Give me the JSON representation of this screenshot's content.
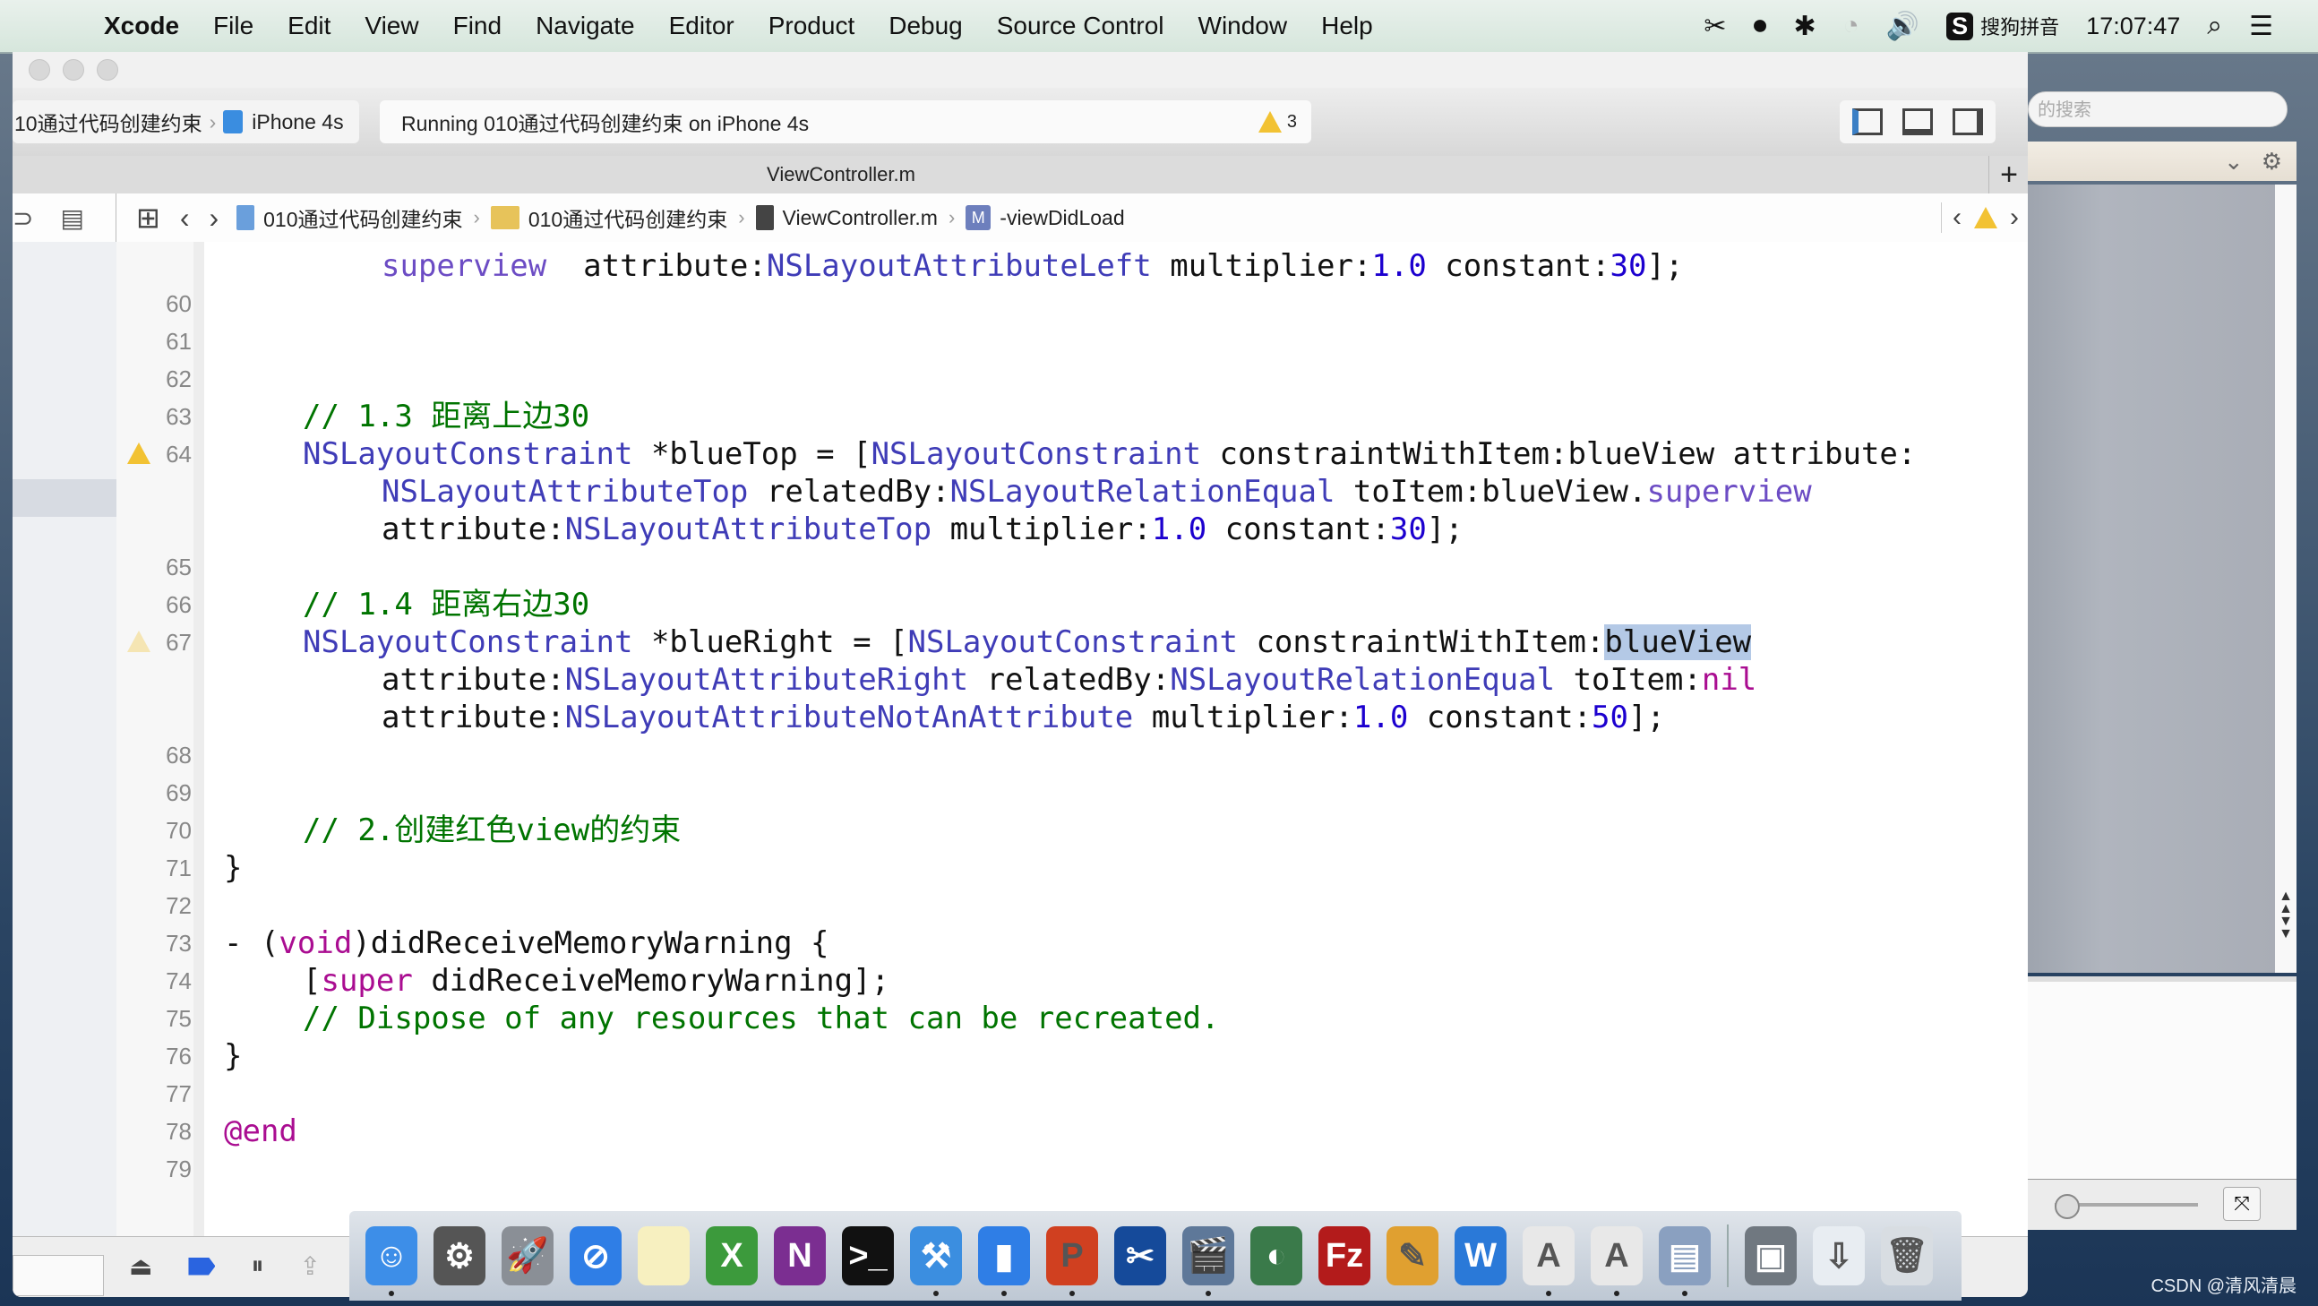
{
  "menubar": {
    "items": [
      "Xcode",
      "File",
      "Edit",
      "View",
      "Find",
      "Navigate",
      "Editor",
      "Product",
      "Debug",
      "Source Control",
      "Window",
      "Help"
    ],
    "input_method": "搜狗拼音",
    "ime_badge": "S",
    "clock": "17:07:47"
  },
  "toolbar": {
    "scheme": "10通过代码创建约束",
    "device": "iPhone 4s",
    "activity": "Running 010通过代码创建约束 on iPhone 4s",
    "warning_count": "3"
  },
  "tab": {
    "title": "ViewController.m",
    "add_label": "+"
  },
  "jumpbar": {
    "crumbs": [
      "010通过代码创建约束",
      "010通过代码创建约束",
      "ViewController.m",
      "-viewDidLoad"
    ],
    "method_badge": "M"
  },
  "editor": {
    "lines": [
      {
        "num": "",
        "text": "superview  attribute:NSLayoutAttributeLeft multiplier:1.0 constant:30];"
      },
      {
        "num": "60",
        "text": ""
      },
      {
        "num": "61",
        "text": ""
      },
      {
        "num": "62",
        "text": ""
      },
      {
        "num": "63",
        "text": "// 1.3 距离上边30"
      },
      {
        "num": "64",
        "text": "NSLayoutConstraint *blueTop = [NSLayoutConstraint constraintWithItem:blueView attribute:",
        "warning": true
      },
      {
        "num": "",
        "text": "NSLayoutAttributeTop relatedBy:NSLayoutRelationEqual toItem:blueView.superview"
      },
      {
        "num": "",
        "text": "attribute:NSLayoutAttributeTop multiplier:1.0 constant:30];"
      },
      {
        "num": "65",
        "text": ""
      },
      {
        "num": "66",
        "text": "// 1.4 距离右边30"
      },
      {
        "num": "67",
        "text": "NSLayoutConstraint *blueRight = [NSLayoutConstraint constraintWithItem:blueView",
        "warning": true
      },
      {
        "num": "",
        "text": "attribute:NSLayoutAttributeRight relatedBy:NSLayoutRelationEqual toItem:nil"
      },
      {
        "num": "",
        "text": "attribute:NSLayoutAttributeNotAnAttribute multiplier:1.0 constant:50];"
      },
      {
        "num": "68",
        "text": ""
      },
      {
        "num": "69",
        "text": ""
      },
      {
        "num": "70",
        "text": "// 2.创建红色view的约束"
      },
      {
        "num": "71",
        "text": "}"
      },
      {
        "num": "72",
        "text": ""
      },
      {
        "num": "73",
        "text": "- (void)didReceiveMemoryWarning {"
      },
      {
        "num": "74",
        "text": "[super didReceiveMemoryWarning];"
      },
      {
        "num": "75",
        "text": "// Dispose of any resources that can be recreated."
      },
      {
        "num": "76",
        "text": "}"
      },
      {
        "num": "77",
        "text": ""
      },
      {
        "num": "78",
        "text": "@end"
      },
      {
        "num": "79",
        "text": ""
      }
    ],
    "selected_token": "blueView"
  },
  "right_pane": {
    "search_placeholder": "的搜索"
  },
  "dock": {
    "apps": [
      {
        "name": "finder",
        "label": "☺",
        "color": "#3d8ee8",
        "running": true
      },
      {
        "name": "system-preferences",
        "label": "⚙",
        "color": "#555555",
        "running": false
      },
      {
        "name": "launchpad",
        "label": "🚀",
        "color": "#8a8f96",
        "running": false
      },
      {
        "name": "safari",
        "label": "⊘",
        "color": "#2f7ee6",
        "running": false
      },
      {
        "name": "notes",
        "label": "",
        "color": "#f7f0c0",
        "running": false
      },
      {
        "name": "excel",
        "label": "X",
        "color": "#3c9a3c",
        "running": false
      },
      {
        "name": "onenote",
        "label": "N",
        "color": "#7b2e91",
        "running": false
      },
      {
        "name": "terminal",
        "label": ">_",
        "color": "#111111",
        "running": false
      },
      {
        "name": "xcode",
        "label": "⚒",
        "color": "#3b8ee0",
        "running": true
      },
      {
        "name": "simulator",
        "label": "▮",
        "color": "#2f7ee6",
        "running": true
      },
      {
        "name": "powerpoint",
        "label": "P",
        "color": "#d04020",
        "running": true
      },
      {
        "name": "snip",
        "label": "✂",
        "color": "#154a9a",
        "running": false
      },
      {
        "name": "clapper",
        "label": "🎬",
        "color": "#5e7899",
        "running": true
      },
      {
        "name": "time-machine",
        "label": "◐",
        "color": "#3a7a4a",
        "running": false
      },
      {
        "name": "filezilla",
        "label": "Fz",
        "color": "#b31b1b",
        "running": false
      },
      {
        "name": "xmind",
        "label": "✎",
        "color": "#e0a030",
        "running": false
      },
      {
        "name": "word",
        "label": "W",
        "color": "#2a79d8",
        "running": false
      },
      {
        "name": "app-a1",
        "label": "A",
        "color": "#e8e8e8",
        "running": true
      },
      {
        "name": "app-a2",
        "label": "A",
        "color": "#e8e8e8",
        "running": true
      },
      {
        "name": "preview",
        "label": "▤",
        "color": "#8aa0c0",
        "running": true
      },
      {
        "name": "screen-share",
        "label": "▣",
        "color": "#707880",
        "running": false
      },
      {
        "name": "downloads",
        "label": "⇩",
        "color": "#e8edf2",
        "running": false
      },
      {
        "name": "trash",
        "label": "🗑",
        "color": "#d8dde2",
        "running": false
      }
    ]
  },
  "watermark": "CSDN @清风清晨"
}
